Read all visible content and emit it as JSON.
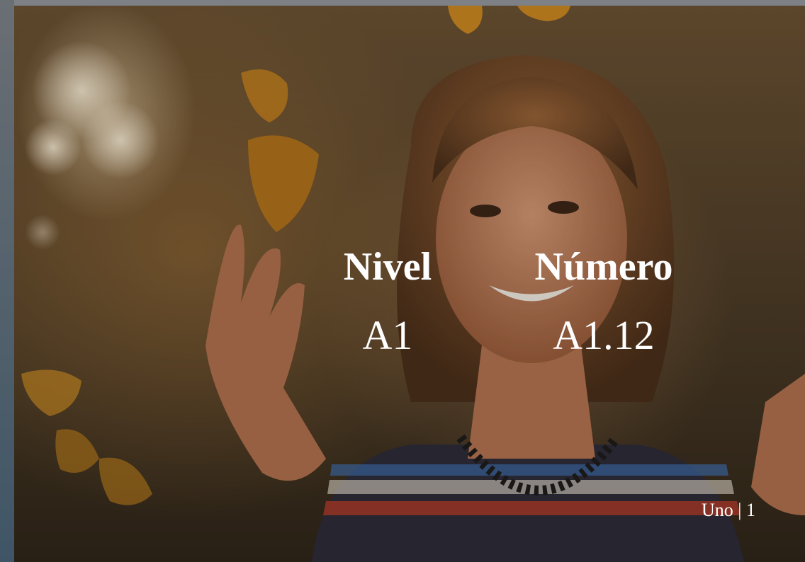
{
  "slide": {
    "headers": {
      "nivel": "Nivel",
      "numero": "Número"
    },
    "values": {
      "nivel": "A1",
      "numero": "A1.12"
    },
    "footer": "Uno | 1"
  },
  "colors": {
    "text": "#ffffff",
    "photo_tone": "#6b5234"
  }
}
